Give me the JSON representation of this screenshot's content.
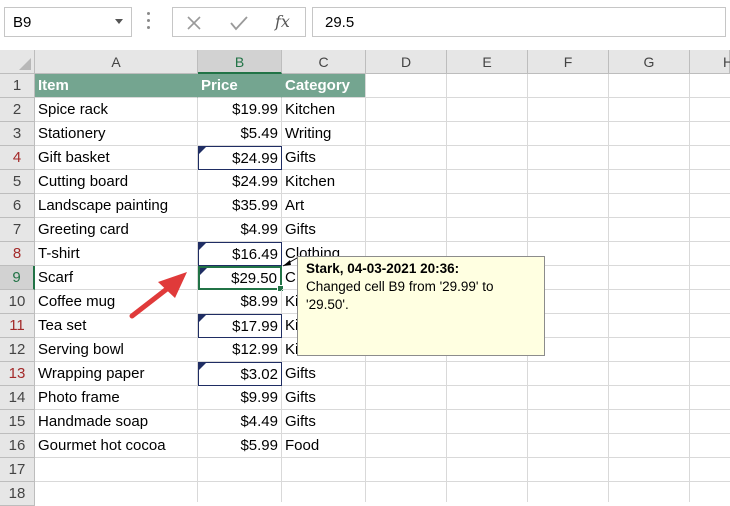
{
  "namebox": {
    "value": "B9"
  },
  "formula": {
    "fx_label": "fx",
    "value": "29.5"
  },
  "colors": {
    "header_fill": "#74a590",
    "active_border": "#217346",
    "tracked_border": "#1f2d63",
    "arrow": "#e03a3a",
    "comment_fill": "#ffffe1"
  },
  "columns": [
    "A",
    "B",
    "C",
    "D",
    "E",
    "F",
    "G",
    "H"
  ],
  "rows": [
    "1",
    "2",
    "3",
    "4",
    "5",
    "6",
    "7",
    "8",
    "9",
    "10",
    "11",
    "12",
    "13",
    "14",
    "15",
    "16",
    "17",
    "18"
  ],
  "table": {
    "header": {
      "item": "Item",
      "price": "Price",
      "category": "Category"
    },
    "data": [
      {
        "item": "Spice rack",
        "price": "$19.99",
        "category": "Kitchen"
      },
      {
        "item": "Stationery",
        "price": "$5.49",
        "category": "Writing"
      },
      {
        "item": "Gift basket",
        "price": "$24.99",
        "category": "Gifts"
      },
      {
        "item": "Cutting board",
        "price": "$24.99",
        "category": "Kitchen"
      },
      {
        "item": "Landscape painting",
        "price": "$35.99",
        "category": "Art"
      },
      {
        "item": "Greeting card",
        "price": "$4.99",
        "category": "Gifts"
      },
      {
        "item": "T-shirt",
        "price": "$16.49",
        "category": "Clothing"
      },
      {
        "item": "Scarf",
        "price": "$29.50",
        "category": "C"
      },
      {
        "item": "Coffee mug",
        "price": "$8.99",
        "category": "Ki"
      },
      {
        "item": "Tea set",
        "price": "$17.99",
        "category": "Ki"
      },
      {
        "item": "Serving bowl",
        "price": "$12.99",
        "category": "Ki"
      },
      {
        "item": "Wrapping paper",
        "price": "$3.02",
        "category": "Gifts"
      },
      {
        "item": "Photo frame",
        "price": "$9.99",
        "category": "Gifts"
      },
      {
        "item": "Handmade soap",
        "price": "$4.49",
        "category": "Gifts"
      },
      {
        "item": "Gourmet hot cocoa",
        "price": "$5.99",
        "category": "Food"
      }
    ]
  },
  "comment": {
    "author_line": "Stark, 04-03-2021 20:36:",
    "text": "Changed cell B9 from '29.99' to '29.50'."
  },
  "active_cell": "B9",
  "changed_rows": [
    4,
    8,
    9,
    11,
    13
  ]
}
